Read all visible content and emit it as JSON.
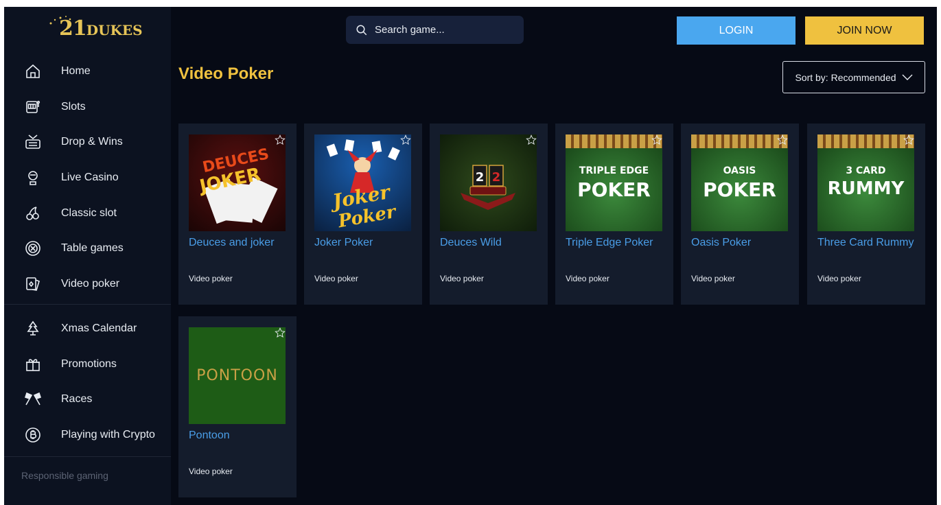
{
  "brand": {
    "logo_text": "21",
    "logo_text2": "DUKES"
  },
  "sidebar": {
    "items": [
      {
        "label": "Home",
        "icon": "home-icon"
      },
      {
        "label": "Slots",
        "icon": "slot-machine-icon"
      },
      {
        "label": "Drop & Wins",
        "icon": "drops-wins-icon"
      },
      {
        "label": "Live Casino",
        "icon": "dealer-icon"
      },
      {
        "label": "Classic slot",
        "icon": "cherries-icon"
      },
      {
        "label": "Table games",
        "icon": "casino-chip-icon"
      },
      {
        "label": "Video poker",
        "icon": "cards-icon"
      }
    ],
    "items2": [
      {
        "label": "Xmas Calendar",
        "icon": "xmas-tree-icon"
      },
      {
        "label": "Promotions",
        "icon": "gift-icon"
      },
      {
        "label": "Races",
        "icon": "race-flags-icon"
      },
      {
        "label": "Playing with Crypto",
        "icon": "bitcoin-icon"
      }
    ],
    "footer": "Responsible gaming"
  },
  "header": {
    "search_placeholder": "Search game...",
    "login_label": "LOGIN",
    "join_label": "JOIN NOW"
  },
  "main": {
    "title": "Video Poker",
    "sort_label": "Sort by: Recommended",
    "games": [
      {
        "title": "Deuces and joker",
        "category": "Video poker",
        "art": "DEUCES & JOKER"
      },
      {
        "title": "Joker Poker",
        "category": "Video poker",
        "art": "Joker Poker"
      },
      {
        "title": "Deuces Wild",
        "category": "Video poker",
        "art": "2 2"
      },
      {
        "title": "Triple Edge Poker",
        "category": "Video poker",
        "art_line1": "TRIPLE EDGE",
        "art_line2": "POKER"
      },
      {
        "title": "Oasis Poker",
        "category": "Video poker",
        "art_line1": "OASIS",
        "art_line2": "POKER"
      },
      {
        "title": "Three Card Rummy",
        "category": "Video poker",
        "art_line1": "3 CARD",
        "art_line2": "RUMMY"
      },
      {
        "title": "Pontoon",
        "category": "Video poker",
        "art": "PONTOON"
      }
    ]
  },
  "colors": {
    "accent_gold": "#efc13f",
    "accent_blue": "#4aa7ef",
    "background": "#060a15",
    "sidebar": "#0c1220",
    "card": "#141c2c"
  }
}
